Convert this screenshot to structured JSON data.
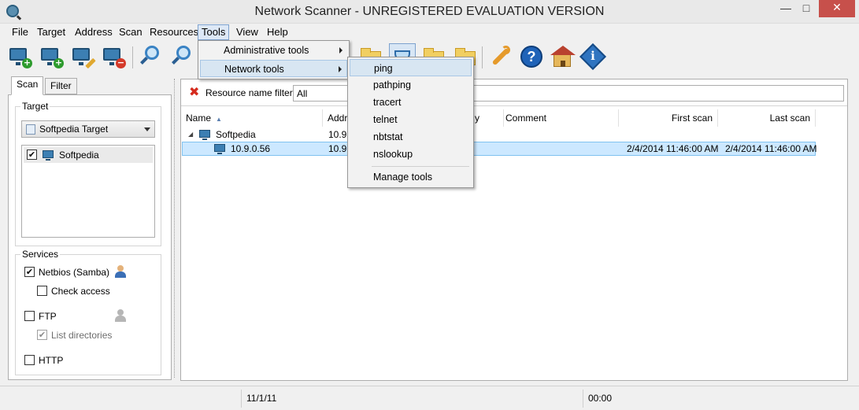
{
  "window": {
    "title": "Network Scanner - UNREGISTERED EVALUATION VERSION"
  },
  "controls": {
    "minimize": "—",
    "maximize": "□",
    "close": "✕"
  },
  "menu": [
    "File",
    "Target",
    "Address",
    "Scan",
    "Resources",
    "Tools",
    "View",
    "Help"
  ],
  "tools_menu": {
    "items": [
      "Administrative tools",
      "Network tools"
    ]
  },
  "network_tools_menu": {
    "items": [
      "ping",
      "pathping",
      "tracert",
      "telnet",
      "nbtstat",
      "nslookup"
    ],
    "manage": "Manage tools"
  },
  "left_panel": {
    "tabs": [
      "Scan",
      "Filter"
    ],
    "target_group": "Target",
    "target_selected": "Softpedia Target",
    "target_list": [
      {
        "label": "Softpedia",
        "checked": "✔"
      }
    ],
    "services_group": "Services",
    "services": {
      "netbios": {
        "label": "Netbios (Samba)",
        "checked": "✔"
      },
      "check_access": {
        "label": "Check access",
        "checked": ""
      },
      "ftp": {
        "label": "FTP",
        "checked": ""
      },
      "list_directories": {
        "label": "List directories",
        "checked": "✔"
      },
      "http": {
        "label": "HTTP",
        "checked": ""
      }
    }
  },
  "right_panel": {
    "filter_label": "Resource name filter",
    "filter_value": "All",
    "columns": {
      "name": "Name",
      "address": "Addr",
      "type": "y",
      "comment": "Comment",
      "first_scan": "First scan",
      "last_scan": "Last scan"
    },
    "sort_indicator": "▲",
    "rows": [
      {
        "name": "Softpedia",
        "address": "10.9",
        "first_scan": "",
        "last_scan": "",
        "toggle": "◢"
      },
      {
        "name": "10.9.0.56",
        "address": "10.9",
        "first_scan": "2/4/2014 11:46:00 AM",
        "last_scan": "2/4/2014 11:46:00 AM"
      }
    ]
  },
  "status": {
    "date": "11/1/11",
    "time": "00:00"
  },
  "colors": {
    "accent": "#3c7fb3",
    "selection": "#cce8ff",
    "close": "#c7504b"
  }
}
